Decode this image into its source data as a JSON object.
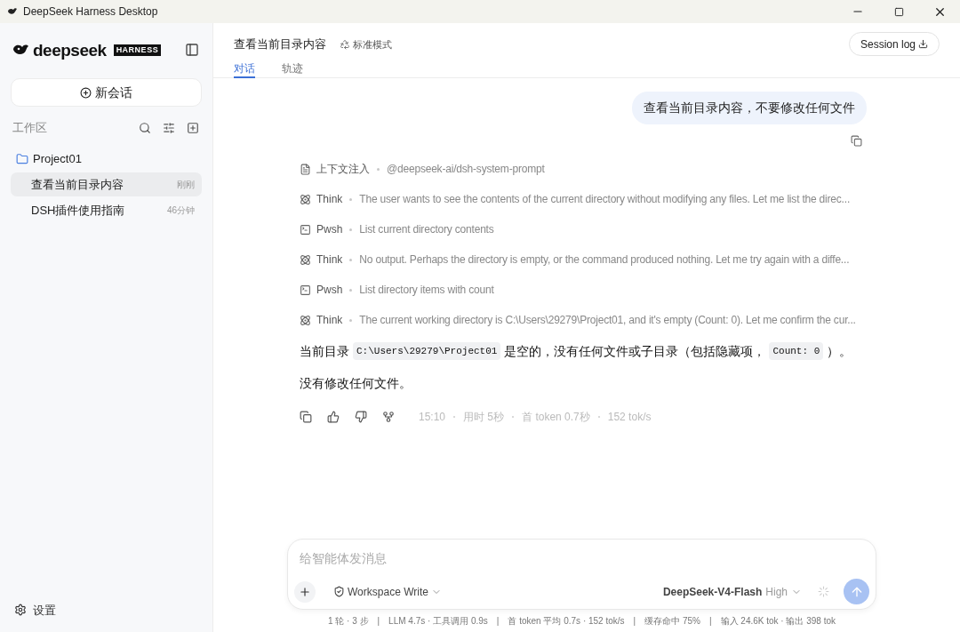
{
  "window": {
    "title": "DeepSeek Harness Desktop"
  },
  "sidebar": {
    "logo": "deepseek",
    "badge": "HARNESS",
    "new_chat": "新会话",
    "workspace_label": "工作区",
    "project": "Project01",
    "sessions": [
      {
        "title": "查看当前目录内容",
        "time": "刚刚",
        "selected": true
      },
      {
        "title": "DSH插件使用指南",
        "time": "46分钟",
        "selected": false
      }
    ],
    "settings": "设置"
  },
  "header": {
    "title": "查看当前目录内容",
    "mode": "标准模式",
    "session_log": "Session log",
    "tabs": [
      {
        "label": "对话",
        "selected": true
      },
      {
        "label": "轨迹",
        "selected": false
      }
    ]
  },
  "user_message": "查看当前目录内容，不要修改任何文件",
  "steps": [
    {
      "kind": "context",
      "label": "上下文注入",
      "text": "@deepseek-ai/dsh-system-prompt"
    },
    {
      "kind": "think",
      "label": "Think",
      "text": "The user wants to see the contents of the current directory without modifying any files. Let me list the direc..."
    },
    {
      "kind": "pwsh",
      "label": "Pwsh",
      "text": "List current directory contents"
    },
    {
      "kind": "think",
      "label": "Think",
      "text": "No output. Perhaps the directory is empty, or the command produced nothing. Let me try again with a diffe..."
    },
    {
      "kind": "pwsh",
      "label": "Pwsh",
      "text": "List directory items with count"
    },
    {
      "kind": "think",
      "label": "Think",
      "text": "The current working directory is C:\\Users\\29279\\Project01, and it's empty (Count: 0). Let me confirm the cur..."
    }
  ],
  "answer": [
    [
      {
        "kind": "text",
        "text": "当前目录"
      },
      {
        "kind": "code",
        "text": "C:\\Users\\29279\\Project01"
      },
      {
        "kind": "text",
        "text": "是空的，没有任何文件或子目录（包括隐藏项，"
      },
      {
        "kind": "code",
        "text": "Count: 0"
      },
      {
        "kind": "text",
        "text": "）。"
      }
    ],
    [
      {
        "kind": "text",
        "text": "没有修改任何文件。"
      }
    ]
  ],
  "meta": [
    "15:10",
    "用时 5秒",
    "首 token 0.7秒",
    "152 tok/s"
  ],
  "composer": {
    "placeholder": "给智能体发消息",
    "permission": "Workspace Write",
    "model": "DeepSeek-V4-Flash",
    "effort": "High"
  },
  "status_bar": "1 轮 · 3 步　|　LLM 4.7s · 工具调用 0.9s　|　首 token 平均 0.7s · 152 tok/s　|　缓存命中 75%　|　输入 24.6K tok · 输出 398 tok"
}
